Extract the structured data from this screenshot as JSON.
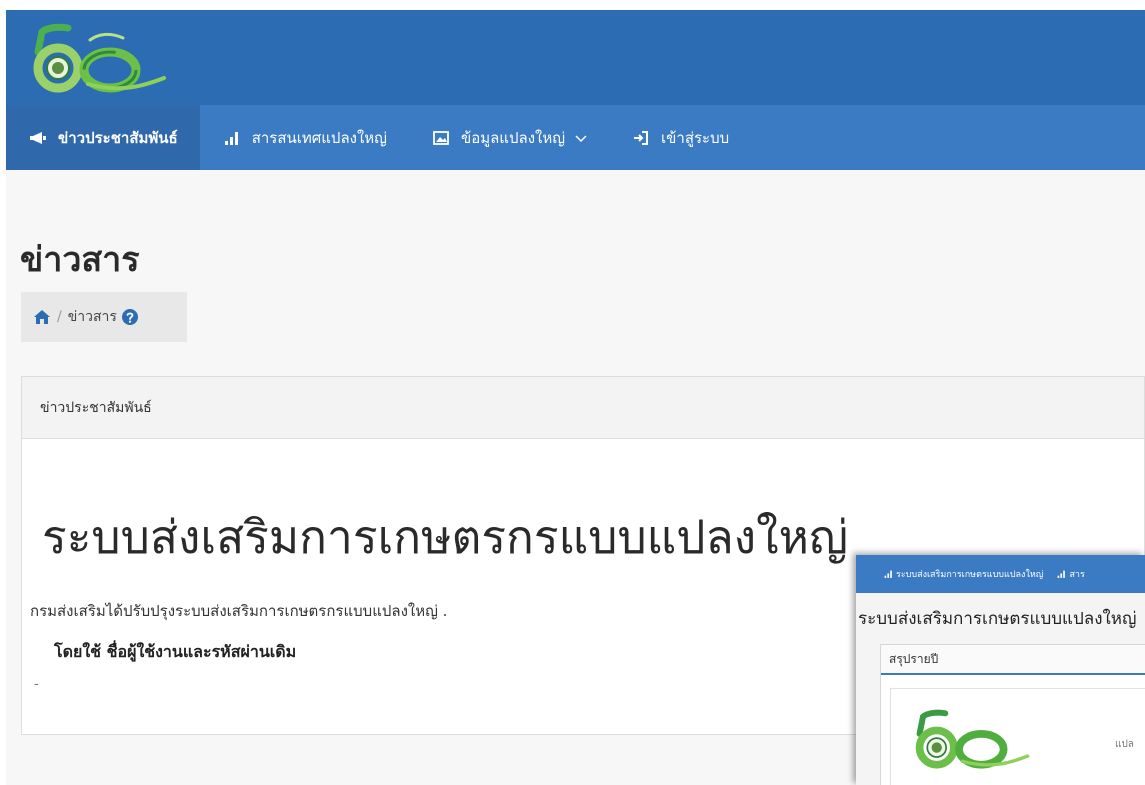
{
  "nav": {
    "items": [
      {
        "label": "ข่าวประชาสัมพันธ์",
        "icon": "megaphone-icon",
        "active": true
      },
      {
        "label": "สารสนเทศแปลงใหญ่",
        "icon": "bar-chart-icon",
        "active": false
      },
      {
        "label": "ข้อมูลแปลงใหญ่",
        "icon": "image-icon",
        "active": false,
        "dropdown": true
      },
      {
        "label": "เข้าสู่ระบบ",
        "icon": "sign-in-icon",
        "active": false
      }
    ]
  },
  "page": {
    "title": "ข่าวสาร",
    "breadcrumb": {
      "current": "ข่าวสาร",
      "separator": "/"
    }
  },
  "card": {
    "header": "ข่าวประชาสัมพันธ์",
    "headline": "ระบบส่งเสริมการเกษตรกรแบบแปลงใหญ่",
    "description": "กรมส่งเสริมได้ปรับปรุงระบบส่งเสริมการเกษตรกรแบบแปลงใหญ่ .",
    "note": "โดยใช้ ชื่อผู้ใช้งานและรหัสผ่านเดิม",
    "trailing": "-"
  },
  "mini": {
    "nav_items": [
      "ระบบส่งเสริมการเกษตรแบบแปลงใหญ่",
      "สาร"
    ],
    "title": "ระบบส่งเสริมการเกษตรแบบแปลงใหญ่",
    "panel_header": "สรุปรายปี",
    "side_text": "แปล"
  },
  "colors": {
    "topbar": "#2b6cb3",
    "navbar": "#3a7bc4",
    "nav_active": "#2f69ac",
    "logo_green": "#3aa04a"
  }
}
